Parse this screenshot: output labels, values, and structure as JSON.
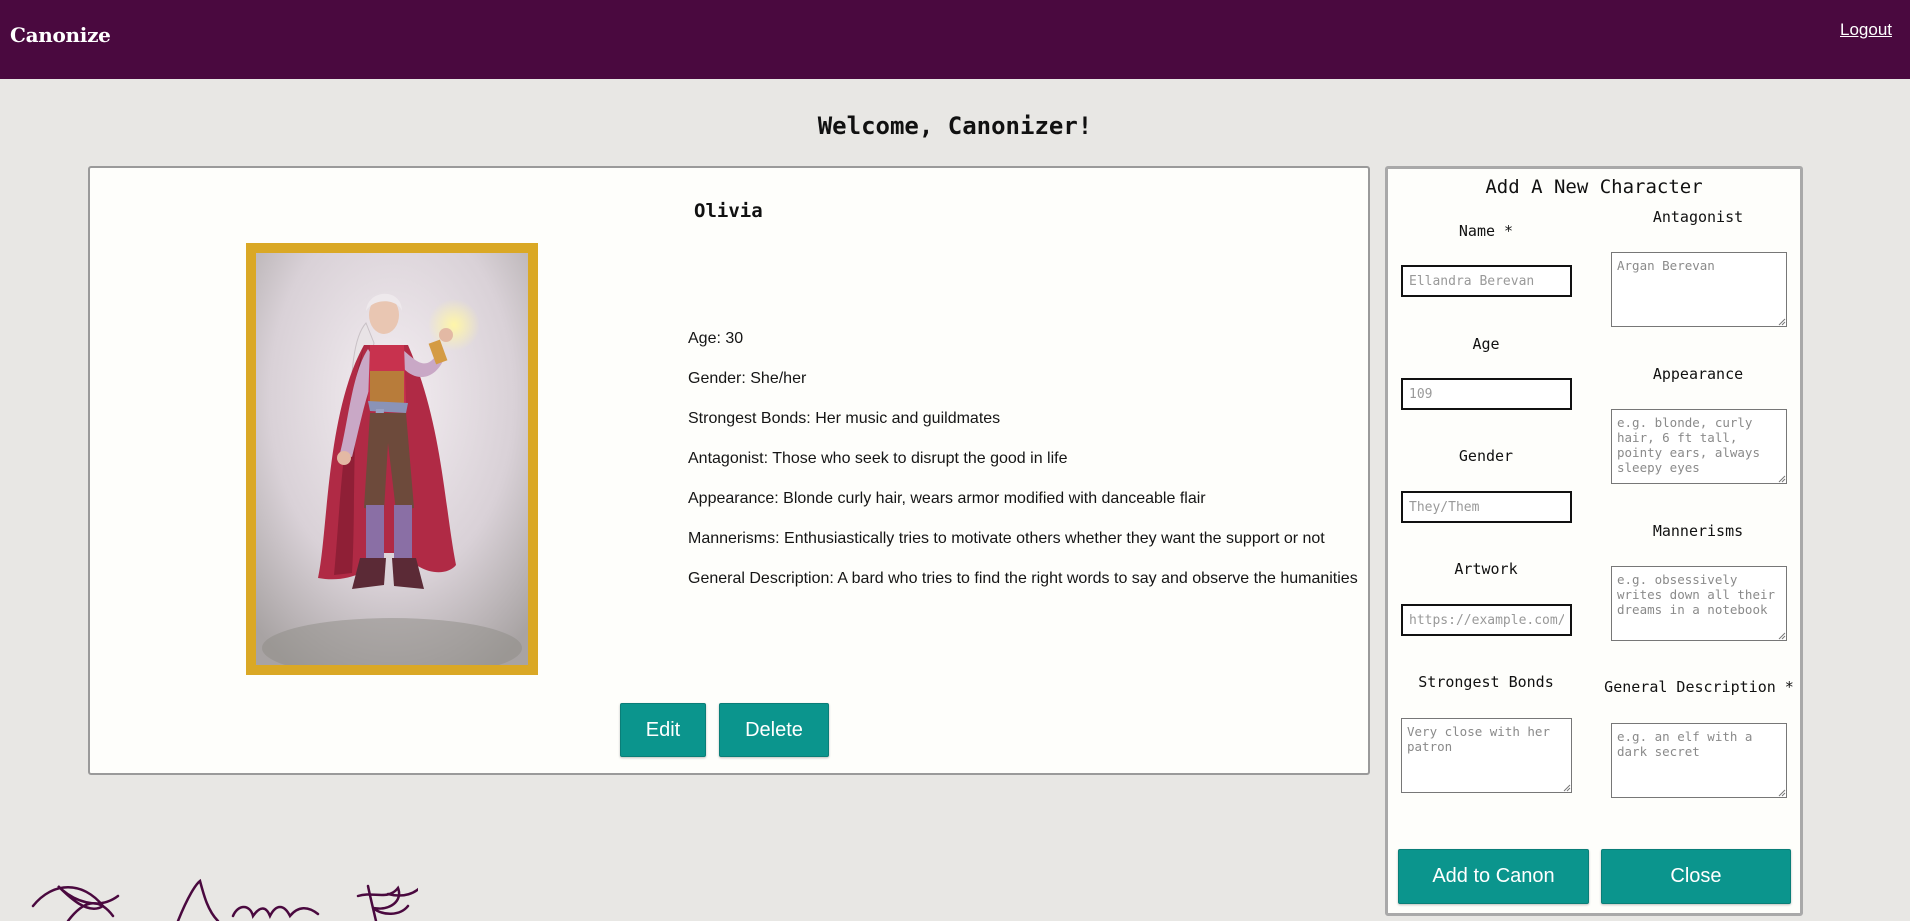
{
  "header": {
    "brand": "Canonize",
    "logout_label": "Logout"
  },
  "welcome": "Welcome, Canonizer!",
  "character": {
    "name": "Olivia",
    "facts": [
      "Age: 30",
      "Gender: She/her",
      "Strongest Bonds: Her music and guildmates",
      "Antagonist: Those who seek to disrupt the good in life",
      "Appearance: Blonde curly hair, wears armor modified with danceable flair",
      "Mannerisms: Enthusiastically tries to motivate others whether they want the support or not",
      "General Description: A bard who tries to find the right words to say and observe the humanities"
    ],
    "edit_label": "Edit",
    "delete_label": "Delete"
  },
  "form": {
    "title": "Add A New Character",
    "name_label": "Name *",
    "name_placeholder": "Ellandra Berevan",
    "age_label": "Age",
    "age_placeholder": "109",
    "gender_label": "Gender",
    "gender_placeholder": "They/Them",
    "artwork_label": "Artwork",
    "artwork_placeholder": "https://example.com/",
    "bonds_label": "Strongest Bonds",
    "bonds_placeholder": "Very close with her patron",
    "antagonist_label": "Antagonist",
    "antagonist_placeholder": "Argan Berevan",
    "appearance_label": "Appearance",
    "appearance_placeholder": "e.g. blonde, curly hair, 6 ft tall, pointy ears, always sleepy eyes",
    "mannerisms_label": "Mannerisms",
    "mannerisms_placeholder": "e.g. obsessively writes down all their dreams in a notebook",
    "description_label": "General Description *",
    "description_placeholder": "e.g. an elf with a dark secret",
    "add_label": "Add to Canon",
    "close_label": "Close"
  },
  "colors": {
    "header_bg": "#4a093f",
    "accent": "#0b958d",
    "frame": "#daa825",
    "page_bg": "#e8e7e4"
  }
}
